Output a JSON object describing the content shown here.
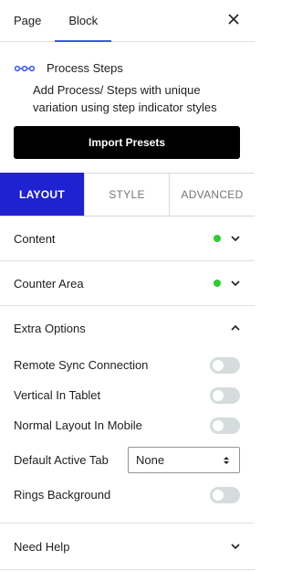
{
  "header": {
    "tabs": [
      {
        "label": "Page"
      },
      {
        "label": "Block"
      }
    ],
    "close_icon": "close-icon"
  },
  "block": {
    "icon": "process-steps-icon",
    "title": "Process Steps",
    "description": "Add Process/ Steps with unique variation using step indicator styles",
    "icon_color": "#3858e9"
  },
  "import_button": {
    "label": "Import Presets"
  },
  "subtabs": [
    {
      "label": "LAYOUT"
    },
    {
      "label": "STYLE"
    },
    {
      "label": "ADVANCED"
    }
  ],
  "panels": {
    "content": {
      "title": "Content"
    },
    "counter_area": {
      "title": "Counter Area"
    },
    "extra_options": {
      "title": "Extra Options",
      "remote_sync": {
        "label": "Remote Sync Connection",
        "enabled": false
      },
      "vertical_tablet": {
        "label": "Vertical In Tablet",
        "enabled": false
      },
      "normal_mobile": {
        "label": "Normal Layout In Mobile",
        "enabled": false
      },
      "default_tab": {
        "label": "Default Active Tab",
        "value": "None"
      },
      "rings_bg": {
        "label": "Rings Background",
        "enabled": false
      }
    },
    "need_help": {
      "title": "Need Help"
    }
  },
  "colors": {
    "accent": "#3858e9",
    "active_tab_bg": "#1e22d0",
    "status_dot": "#2ecc2e",
    "toggle_off": "#d5dcdc"
  }
}
